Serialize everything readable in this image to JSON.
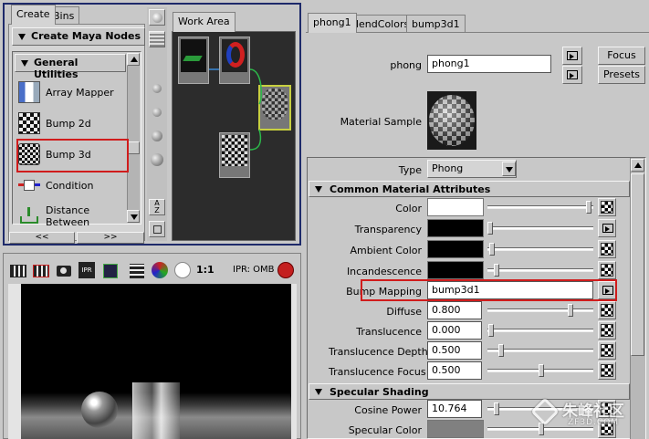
{
  "left_panel": {
    "tabs": [
      "Create",
      "Bins"
    ],
    "create_nodes_label": "Create Maya Nodes",
    "category": "General Utilities",
    "nodes": [
      "Array Mapper",
      "Bump 2d",
      "Bump 3d",
      "Condition",
      "Distance Between"
    ],
    "selected_node": "Bump 3d",
    "nav_prev": "<<",
    "nav_next": ">>"
  },
  "work_area": {
    "tab": "Work Area"
  },
  "render_toolbar": {
    "ratio": "1:1",
    "ipr_text": "IPR: OMB",
    "icons": [
      "render-icon",
      "ipr-render-icon",
      "snapshot-icon",
      "ipr-icon",
      "region-icon",
      "render-settings-icon",
      "rgb-channels-icon",
      "alpha-channel-icon"
    ]
  },
  "attribute_editor": {
    "tabs": [
      "phong1",
      "blendColors",
      "bump3d1"
    ],
    "node_type_label": "phong",
    "node_name": "phong1",
    "focus_label": "Focus",
    "presets_label": "Presets",
    "material_sample_label": "Material Sample",
    "type_label": "Type",
    "type_value": "Phong",
    "common_section": "Common Material Attributes",
    "attributes": [
      {
        "label": "Color",
        "kind": "color",
        "color": "#ffffff",
        "slider": 1.0
      },
      {
        "label": "Transparency",
        "kind": "color",
        "color": "#000000",
        "slider": 0.0
      },
      {
        "label": "Ambient Color",
        "kind": "color",
        "color": "#000000",
        "slider": 0.0
      },
      {
        "label": "Incandescence",
        "kind": "color",
        "color": "#000000",
        "slider": 0.05
      },
      {
        "label": "Bump Mapping",
        "kind": "text",
        "value": "bump3d1"
      },
      {
        "label": "Diffuse",
        "kind": "number",
        "value": "0.800",
        "slider": 0.8
      },
      {
        "label": "Translucence",
        "kind": "number",
        "value": "0.000",
        "slider": 0.0
      },
      {
        "label": "Translucence Depth",
        "kind": "number",
        "value": "0.500",
        "slider": 0.1
      },
      {
        "label": "Translucence Focus",
        "kind": "number",
        "value": "0.500",
        "slider": 0.5
      }
    ],
    "specular_section": "Specular Shading",
    "specular_attributes": [
      {
        "label": "Cosine Power",
        "kind": "number",
        "value": "10.764",
        "slider": 0.06
      },
      {
        "label": "Specular Color",
        "kind": "color",
        "color": "#808080",
        "slider": 0.5
      }
    ]
  },
  "watermark": {
    "text": "朱峰社区",
    "sub": "ZF3D.COM"
  }
}
